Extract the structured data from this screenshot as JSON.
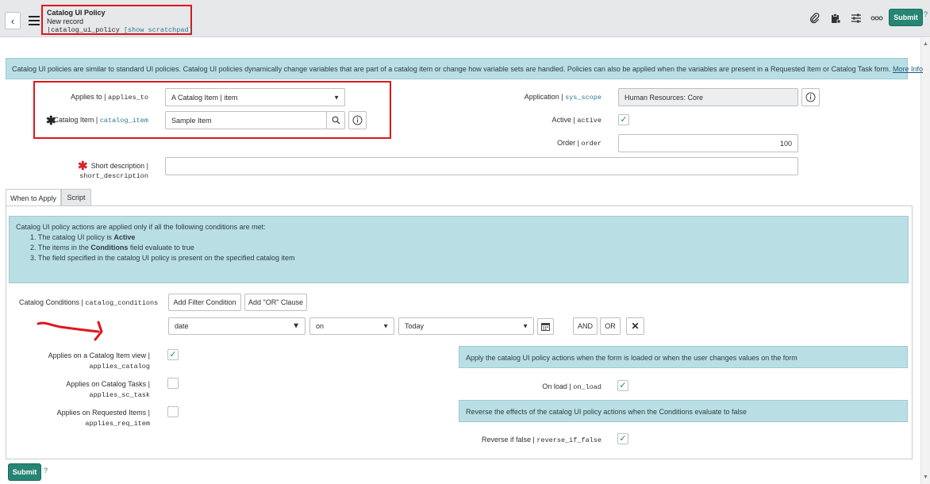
{
  "header": {
    "title": "Catalog UI Policy",
    "subtitle": "New record",
    "table_name": "|catalog_ui_policy",
    "scratchpad_link": "[show scratchpad]",
    "submit_label": "Submit",
    "help": "?",
    "icons": [
      "paperclip-icon",
      "clipboard-icon",
      "sliders-icon",
      "more-icon"
    ]
  },
  "banner": {
    "text": "Catalog UI policies are similar to standard UI policies. Catalog UI policies dynamically change variables that are part of a catalog item or change how variable sets are handled. Policies can also be applied when the variables are present in a Requested Item or Catalog Task form.",
    "link": "More Info"
  },
  "form": {
    "applies_to": {
      "label": "Applies to |",
      "name": "applies_to",
      "value": "A Catalog Item | item"
    },
    "catalog_item": {
      "label": "Catalog Item |",
      "name": "catalog_item",
      "value": "Sample Item"
    },
    "application": {
      "label": "Application |",
      "name": "sys_scope",
      "value": "Human Resources: Core"
    },
    "active": {
      "label": "Active |",
      "name": "active",
      "checked": true
    },
    "order": {
      "label": "Order |",
      "name": "order",
      "value": "100"
    },
    "short_description": {
      "label": "Short description |",
      "name": "short_description",
      "value": ""
    }
  },
  "tabs": [
    {
      "label": "When to Apply",
      "active": true
    },
    {
      "label": "Script",
      "active": false
    }
  ],
  "conditions_info": {
    "intro": "Catalog UI policy actions are applied only if all the following conditions are met:",
    "items": [
      {
        "pre": "1. The catalog UI policy is ",
        "bold": "Active",
        "post": ""
      },
      {
        "pre": "2. The items in the ",
        "bold": "Conditions",
        "post": " field evaluate to true"
      },
      {
        "pre": "3. The field specified in the catalog UI policy is present on the specified catalog item",
        "bold": "",
        "post": ""
      }
    ]
  },
  "catalog_conditions": {
    "label": "Catalog Conditions |",
    "name": "catalog_conditions",
    "add_filter_label": "Add Filter Condition",
    "add_or_label": "Add \"OR\" Clause",
    "field": "date",
    "operator": "on",
    "value": "Today",
    "and_label": "AND",
    "or_label": "OR",
    "remove_label": "✕"
  },
  "applies": {
    "catalog_view": {
      "label": "Applies on a Catalog Item view |",
      "name": "applies_catalog",
      "checked": true
    },
    "sc_task": {
      "label": "Applies on Catalog Tasks |",
      "name": "applies_sc_task",
      "checked": false
    },
    "req_item": {
      "label": "Applies on Requested Items |",
      "name": "applies_req_item",
      "checked": false
    }
  },
  "onload_info": "Apply the catalog UI policy actions when the form is loaded or when the user changes values on the form",
  "on_load": {
    "label": "On load |",
    "name": "on_load",
    "checked": true
  },
  "reverse_info": "Reverse the effects of the catalog UI policy actions when the Conditions evaluate to false",
  "reverse_if_false": {
    "label": "Reverse if false |",
    "name": "reverse_if_false",
    "checked": true
  },
  "footer": {
    "submit_label": "Submit",
    "help": "?"
  },
  "colors": {
    "accent": "#278574",
    "info_bg": "#b9dfe5",
    "highlight": "#e0161c",
    "annotation": "#e0161c"
  }
}
